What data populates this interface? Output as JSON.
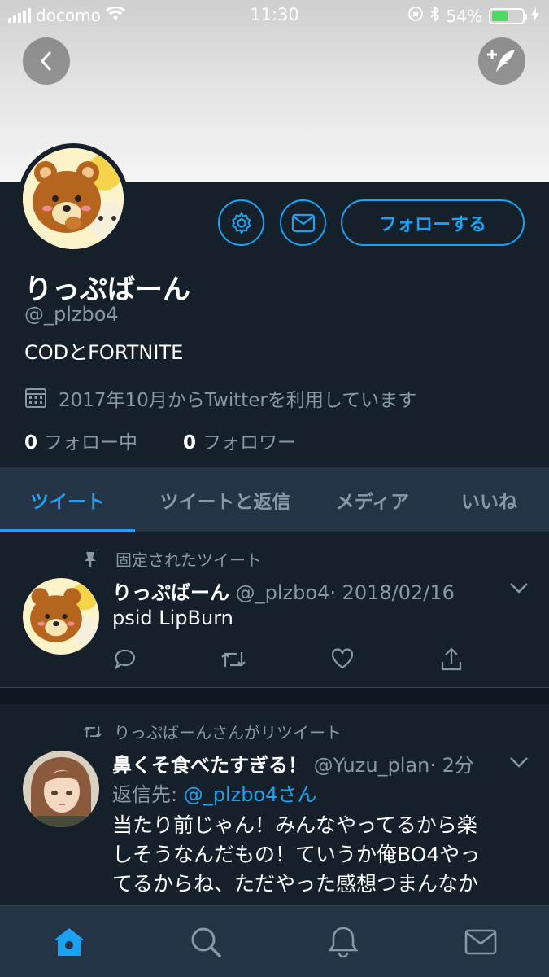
{
  "status_bar": {
    "carrier": "docomo",
    "time": "11:30",
    "battery": "54%",
    "icons": [
      "signal-icon",
      "wifi-icon",
      "rotation-lock-icon",
      "bluetooth-icon",
      "battery-icon",
      "charging-icon"
    ]
  },
  "header": {
    "back_icon": "chevron-left-icon",
    "compose_icon": "compose-tweet-icon"
  },
  "profile": {
    "name": "りっぷばーん",
    "handle": "@_plzbo4",
    "bio": "CODとFORTNITE",
    "joined": "2017年10月からTwitterを利用しています",
    "following_count": "0",
    "following_label": "フォロー中",
    "followers_count": "0",
    "followers_label": "フォロワー",
    "follow_button": "フォローする"
  },
  "tabs": [
    {
      "label": "ツイート",
      "active": true
    },
    {
      "label": "ツイートと返信",
      "active": false
    },
    {
      "label": "メディア",
      "active": false
    },
    {
      "label": "いいね",
      "active": false
    }
  ],
  "tweets": [
    {
      "context": "固定されたツイート",
      "name": "りっぷばーん",
      "handle": "@_plzbo4",
      "date": "· 2018/02/16",
      "text": "psid LipBurn"
    },
    {
      "context": "りっぷばーんさんがリツイート",
      "name": "鼻くそ食べたすぎる！",
      "handle": "@Yuzu_plan",
      "date": "· 2分",
      "reply_prefix": "返信先:",
      "reply_mention": "@_plzbo4さん",
      "text_lines": [
        "当たり前じゃん！みんなやってるから楽",
        "しそうなんだもの！ていうか俺BO4やっ",
        "てるからね、ただやった感想つまんなか"
      ]
    }
  ],
  "colors": {
    "background": "#15202b",
    "panel": "#243447",
    "accent": "#1da1f2",
    "secondary_text": "#8899a6"
  }
}
